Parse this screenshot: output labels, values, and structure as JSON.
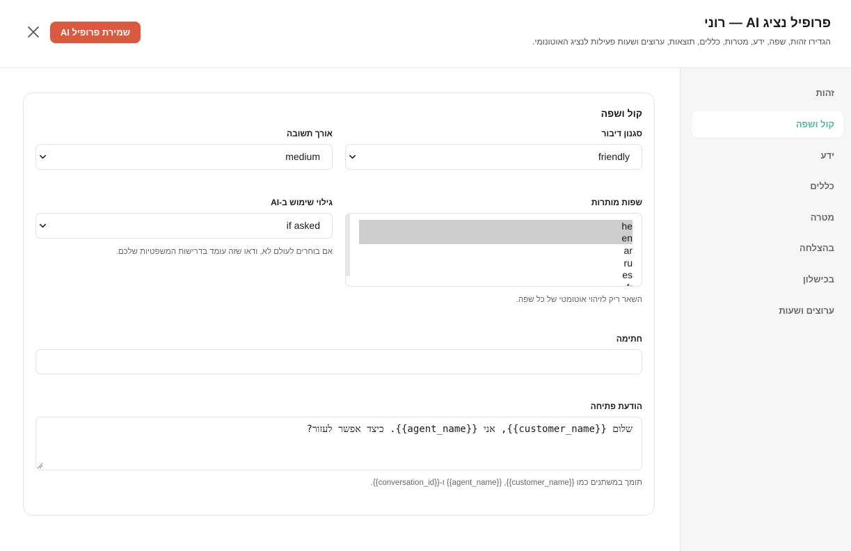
{
  "header": {
    "title": "פרופיל נציג AI — רוני",
    "subtitle": "הגדירו זהות, שפה, ידע, מטרות, כללים, תוצאות, ערוצים ושעות פעילות לנציג האוטונומי.",
    "save_label": "שמירת פרופיל AI",
    "close_icon": "close-icon"
  },
  "sidebar": {
    "items": [
      {
        "label": "זהות",
        "active": false
      },
      {
        "label": "קול ושפה",
        "active": true
      },
      {
        "label": "ידע",
        "active": false
      },
      {
        "label": "כללים",
        "active": false
      },
      {
        "label": "מטרה",
        "active": false
      },
      {
        "label": "בהצלחה",
        "active": false
      },
      {
        "label": "בכישלון",
        "active": false
      },
      {
        "label": "ערוצים ושעות",
        "active": false
      }
    ],
    "active_color": "#4fb99f"
  },
  "main": {
    "section_title": "קול ושפה",
    "speech_style": {
      "label": "סגנון דיבור",
      "value": "friendly"
    },
    "response_length": {
      "label": "אורך תשובה",
      "value": "medium"
    },
    "languages": {
      "label": "שפות מותרות",
      "options": [
        "he",
        "en",
        "ar",
        "ru",
        "es",
        "fr"
      ],
      "selected": [
        "he",
        "en"
      ],
      "help": "השאר ריק לזיהוי אוטומטי של כל שפה."
    },
    "ai_disclosure": {
      "label": "גילוי שימוש ב-AI",
      "value": "if asked",
      "help": "אם בוחרים לעולם לא, ודאו שזה עומד בדרישות המשפטיות שלכם."
    },
    "signature": {
      "label": "חתימה",
      "value": ""
    },
    "greeting": {
      "label": "הודעת פתיחה",
      "value": "שלום {{customer_name}}, אני {{agent_name}}. כיצד אפשר לעזור?",
      "help": "תומך במשתנים כמו {{customer_name}}, {{agent_name}} ו-{{conversation_id}}."
    }
  },
  "colors": {
    "accent": "#d95a40",
    "active_nav": "#4fb99f"
  }
}
